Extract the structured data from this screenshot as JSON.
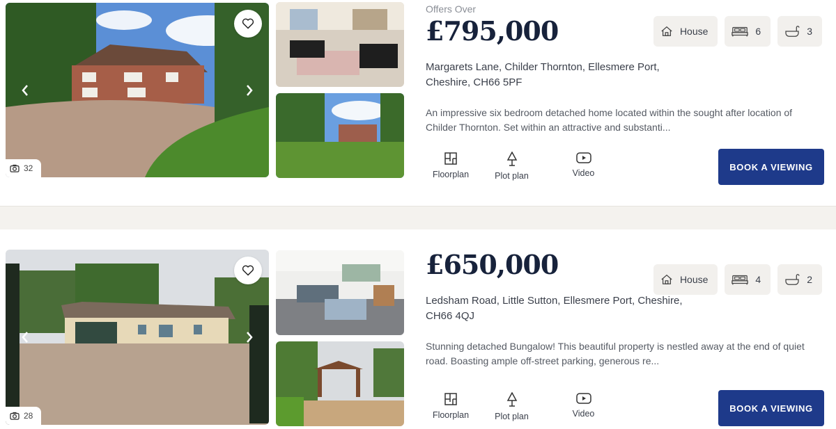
{
  "listings": [
    {
      "offers_label": "Offers Over",
      "price": "£795,000",
      "address_line1": "Margarets Lane, Childer Thornton, Ellesmere Port,",
      "address_line2": "Cheshire, CH66 5PF",
      "description_line1": "An impressive six bedroom detached home located within the sought after location of",
      "description_line2": "Childer Thornton. Set within an attractive and substanti...",
      "property_type": "House",
      "bedrooms": "6",
      "bathrooms": "3",
      "photo_count": "32",
      "links": {
        "floorplan": "Floorplan",
        "plot_plan": "Plot plan",
        "video": "Video"
      },
      "book_label": "BOOK A VIEWING"
    },
    {
      "offers_label": "",
      "price": "£650,000",
      "address_line1": "Ledsham Road, Little Sutton, Ellesmere Port, Cheshire,",
      "address_line2": "CH66 4QJ",
      "description_line1": "Stunning detached Bungalow! This beautiful property is nestled away at the end of quiet",
      "description_line2": "road. Boasting ample off-street parking, generous re...",
      "property_type": "House",
      "bedrooms": "4",
      "bathrooms": "2",
      "photo_count": "28",
      "links": {
        "floorplan": "Floorplan",
        "plot_plan": "Plot plan",
        "video": "Video"
      },
      "book_label": "BOOK A VIEWING"
    }
  ],
  "icons": {
    "favorite": "heart-icon",
    "prev": "chevron-left-icon",
    "next": "chevron-right-icon",
    "camera": "camera-icon",
    "house": "house-icon",
    "bed": "bed-icon",
    "bath": "bath-icon",
    "floorplan": "floorplan-icon",
    "plot_plan": "tree-icon",
    "video": "play-icon"
  },
  "colors": {
    "price": "#17223b",
    "button": "#1e3a8a",
    "badge_bg": "#f2f0ed",
    "divider_bg": "#f4f2ee"
  }
}
